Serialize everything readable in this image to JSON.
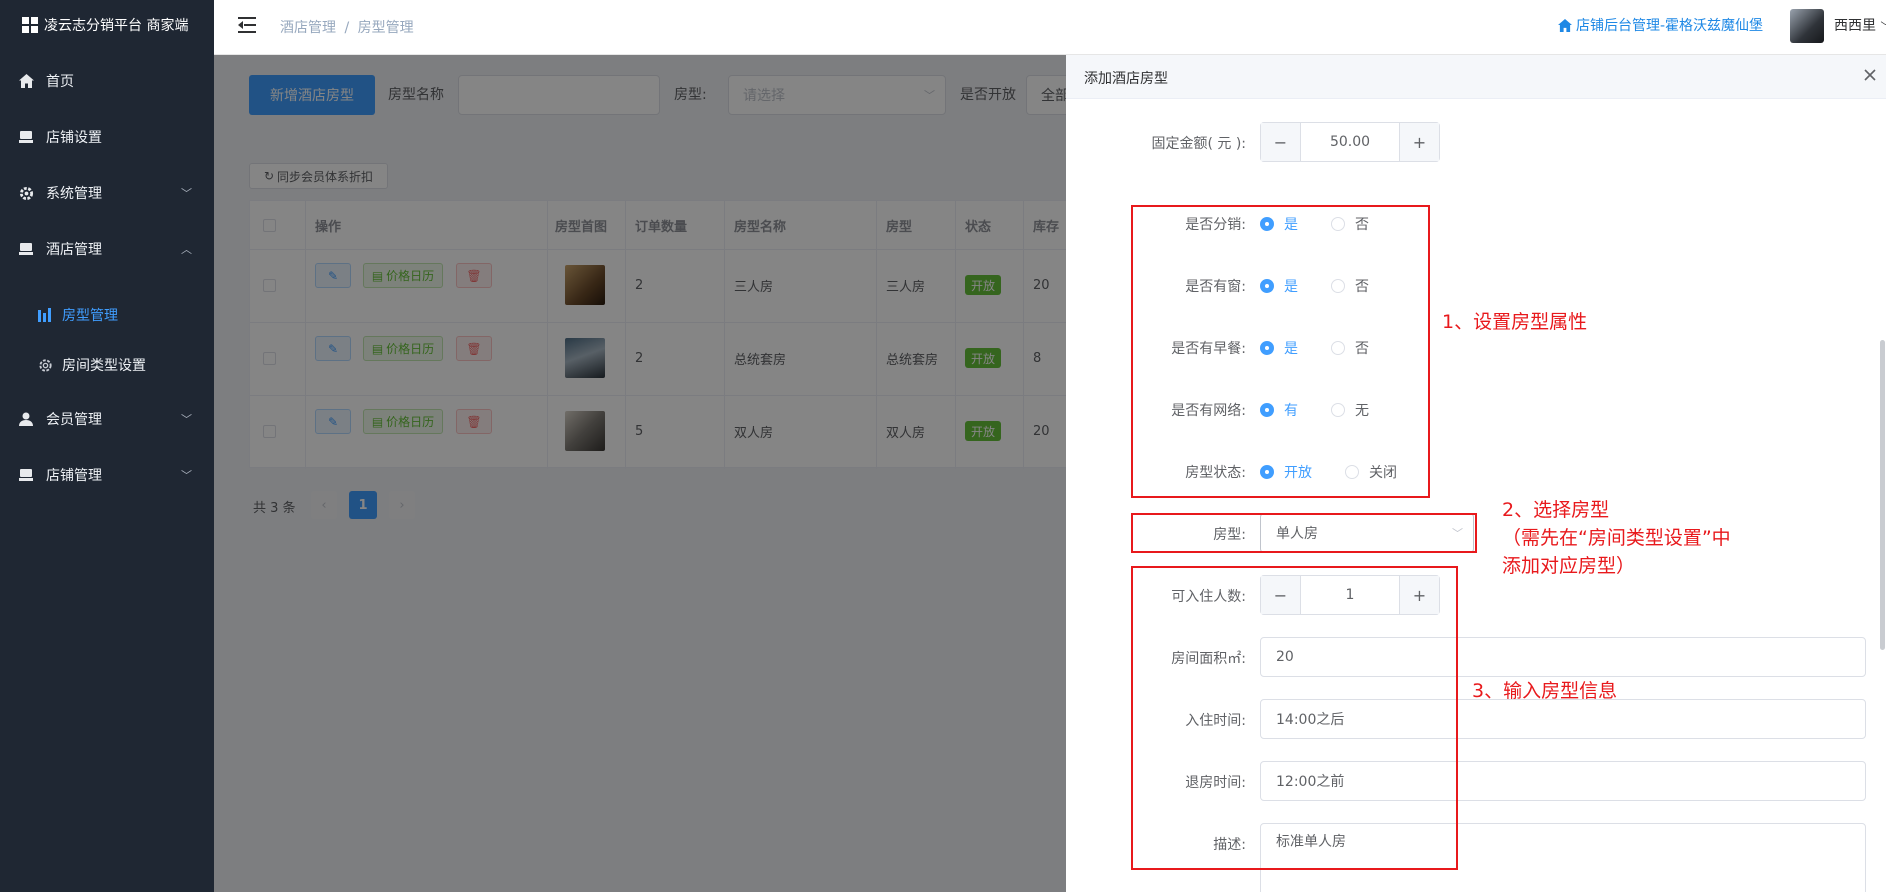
{
  "app": {
    "title": "凌云志分销平台 商家端"
  },
  "sidebar": {
    "items": [
      {
        "label": "首页",
        "icon": "home-icon"
      },
      {
        "label": "店铺设置",
        "icon": "store-icon"
      },
      {
        "label": "系统管理",
        "icon": "gear-icon"
      },
      {
        "label": "酒店管理",
        "icon": "store-icon"
      },
      {
        "label": "会员管理",
        "icon": "user-icon"
      },
      {
        "label": "店铺管理",
        "icon": "store-icon"
      }
    ],
    "sub_items": [
      {
        "label": "房型管理",
        "icon": "chart-icon",
        "active": true
      },
      {
        "label": "房间类型设置",
        "icon": "gear-icon",
        "active": false
      }
    ]
  },
  "header": {
    "breadcrumb_parent": "酒店管理",
    "breadcrumb_sep": "/",
    "breadcrumb_current": "房型管理",
    "home_link": "店铺后台管理-霍格沃兹魔仙堡",
    "user_name": "西西里"
  },
  "toolbar": {
    "add_button": "新增酒店房型",
    "name_label": "房型名称",
    "name_placeholder": "",
    "type_label": "房型:",
    "type_placeholder": "请选择",
    "open_label": "是否开放",
    "open_value": "全部",
    "sync_button": "同步会员体系折扣"
  },
  "table": {
    "headers": [
      "操作",
      "房型首图",
      "订单数量",
      "房型名称",
      "房型",
      "状态",
      "库存"
    ],
    "price_calendar_label": "价格日历",
    "rows": [
      {
        "orders": "2",
        "name": "三人房",
        "type": "三人房",
        "status": "开放",
        "stock": "20"
      },
      {
        "orders": "2",
        "name": "总统套房",
        "type": "总统套房",
        "status": "开放",
        "stock": "8"
      },
      {
        "orders": "5",
        "name": "双人房",
        "type": "双人房",
        "status": "开放",
        "stock": "20"
      }
    ]
  },
  "pagination": {
    "total": "共 3 条",
    "current_page": "1"
  },
  "drawer": {
    "title": "添加酒店房型",
    "fixed_amount_label": "固定金额( 元 ):",
    "fixed_amount_value": "50.00",
    "radios": [
      {
        "label": "是否分销:",
        "yes": "是",
        "no": "否"
      },
      {
        "label": "是否有窗:",
        "yes": "是",
        "no": "否"
      },
      {
        "label": "是否有早餐:",
        "yes": "是",
        "no": "否"
      },
      {
        "label": "是否有网络:",
        "yes": "有",
        "no": "无"
      },
      {
        "label": "房型状态:",
        "yes": "开放",
        "no": "关闭"
      }
    ],
    "room_type_label": "房型:",
    "room_type_value": "单人房",
    "capacity_label": "可入住人数:",
    "capacity_value": "1",
    "area_label": "房间面积㎡:",
    "area_value": "20",
    "checkin_label": "入住时间:",
    "checkin_value": "14:00之后",
    "checkout_label": "退房时间:",
    "checkout_value": "12:00之前",
    "desc_label": "描述:",
    "desc_value": "标准单人房"
  },
  "annotations": {
    "note1": "1、设置房型属性",
    "note2_line1": "2、选择房型",
    "note2_line2": "（需先在“房间类型设置”中",
    "note2_line3": "添加对应房型）",
    "note3": "3、输入房型信息",
    "color": "#e8191c"
  },
  "colors": {
    "sidebar_bg": "#1f2733",
    "primary": "#409eff",
    "success": "#67c23a",
    "danger": "#f56c6c"
  }
}
